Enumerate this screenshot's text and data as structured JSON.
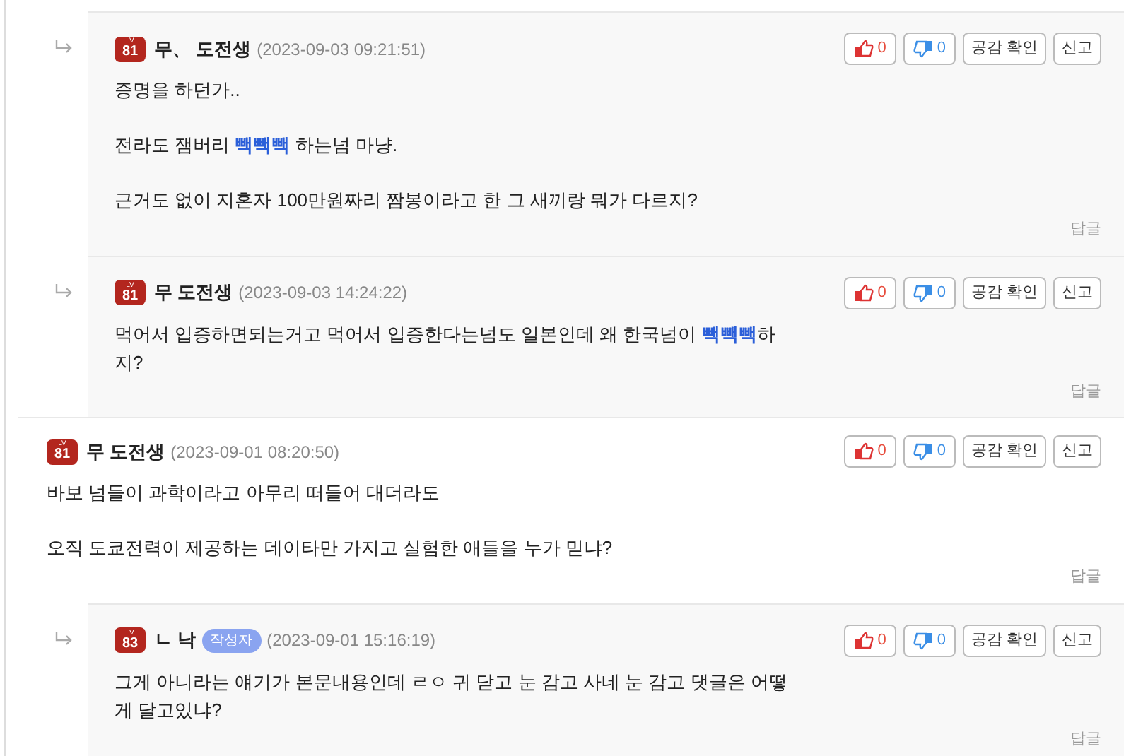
{
  "comments": [
    {
      "reply": true,
      "level": "81",
      "level_label": "LV",
      "name": "무、 도전생",
      "author": false,
      "time": "(2023-09-03 09:21:51)",
      "likes": "0",
      "dislikes": "0",
      "empathy": "공감 확인",
      "report": "신고",
      "reply_link": "답글",
      "paragraphs": [
        [
          {
            "text": "증명을 하던가..",
            "highlight": false
          }
        ],
        [
          {
            "text": "전라도 잼버리 ",
            "highlight": false
          },
          {
            "text": "빽빽빽",
            "highlight": true
          },
          {
            "text": " 하는넘 마냥.",
            "highlight": false
          }
        ],
        [
          {
            "text": "근거도 없이 지혼자 100만원짜리 짬봉이라고 한 그 새끼랑 뭐가 다르지?",
            "highlight": false
          }
        ]
      ]
    },
    {
      "reply": true,
      "level": "81",
      "level_label": "LV",
      "name": "무 도전생",
      "author": false,
      "time": "(2023-09-03 14:24:22)",
      "likes": "0",
      "dislikes": "0",
      "empathy": "공감 확인",
      "report": "신고",
      "reply_link": "답글",
      "paragraphs": [
        [
          {
            "text": "먹어서 입증하면되는거고 먹어서 입증한다는넘도 일본인데 왜 한국넘이 ",
            "highlight": false
          },
          {
            "text": "빽빽빽",
            "highlight": true
          },
          {
            "text": "하지?",
            "highlight": false
          }
        ]
      ]
    },
    {
      "reply": false,
      "level": "81",
      "level_label": "LV",
      "name": "무 도전생",
      "author": false,
      "time": "(2023-09-01 08:20:50)",
      "likes": "0",
      "dislikes": "0",
      "empathy": "공감 확인",
      "report": "신고",
      "reply_link": "답글",
      "paragraphs": [
        [
          {
            "text": "바보 넘들이 과학이라고 아무리 떠들어 대더라도",
            "highlight": false
          }
        ],
        [
          {
            "text": "오직 도쿄전력이 제공하는 데이타만 가지고 실험한 애들을 누가 믿냐?",
            "highlight": false
          }
        ]
      ]
    },
    {
      "reply": true,
      "level": "83",
      "level_label": "LV",
      "name": "ㄴ 낙",
      "author": true,
      "author_label": "작성자",
      "time": "(2023-09-01 15:16:19)",
      "likes": "0",
      "dislikes": "0",
      "empathy": "공감 확인",
      "report": "신고",
      "reply_link": "답글",
      "paragraphs": [
        [
          {
            "text": "그게 아니라는 얘기가 본문내용인데 ㄹㅇ 귀 닫고 눈 감고 사네 눈 감고 댓글은 어떻게 달고있냐?",
            "highlight": false
          }
        ]
      ]
    }
  ]
}
